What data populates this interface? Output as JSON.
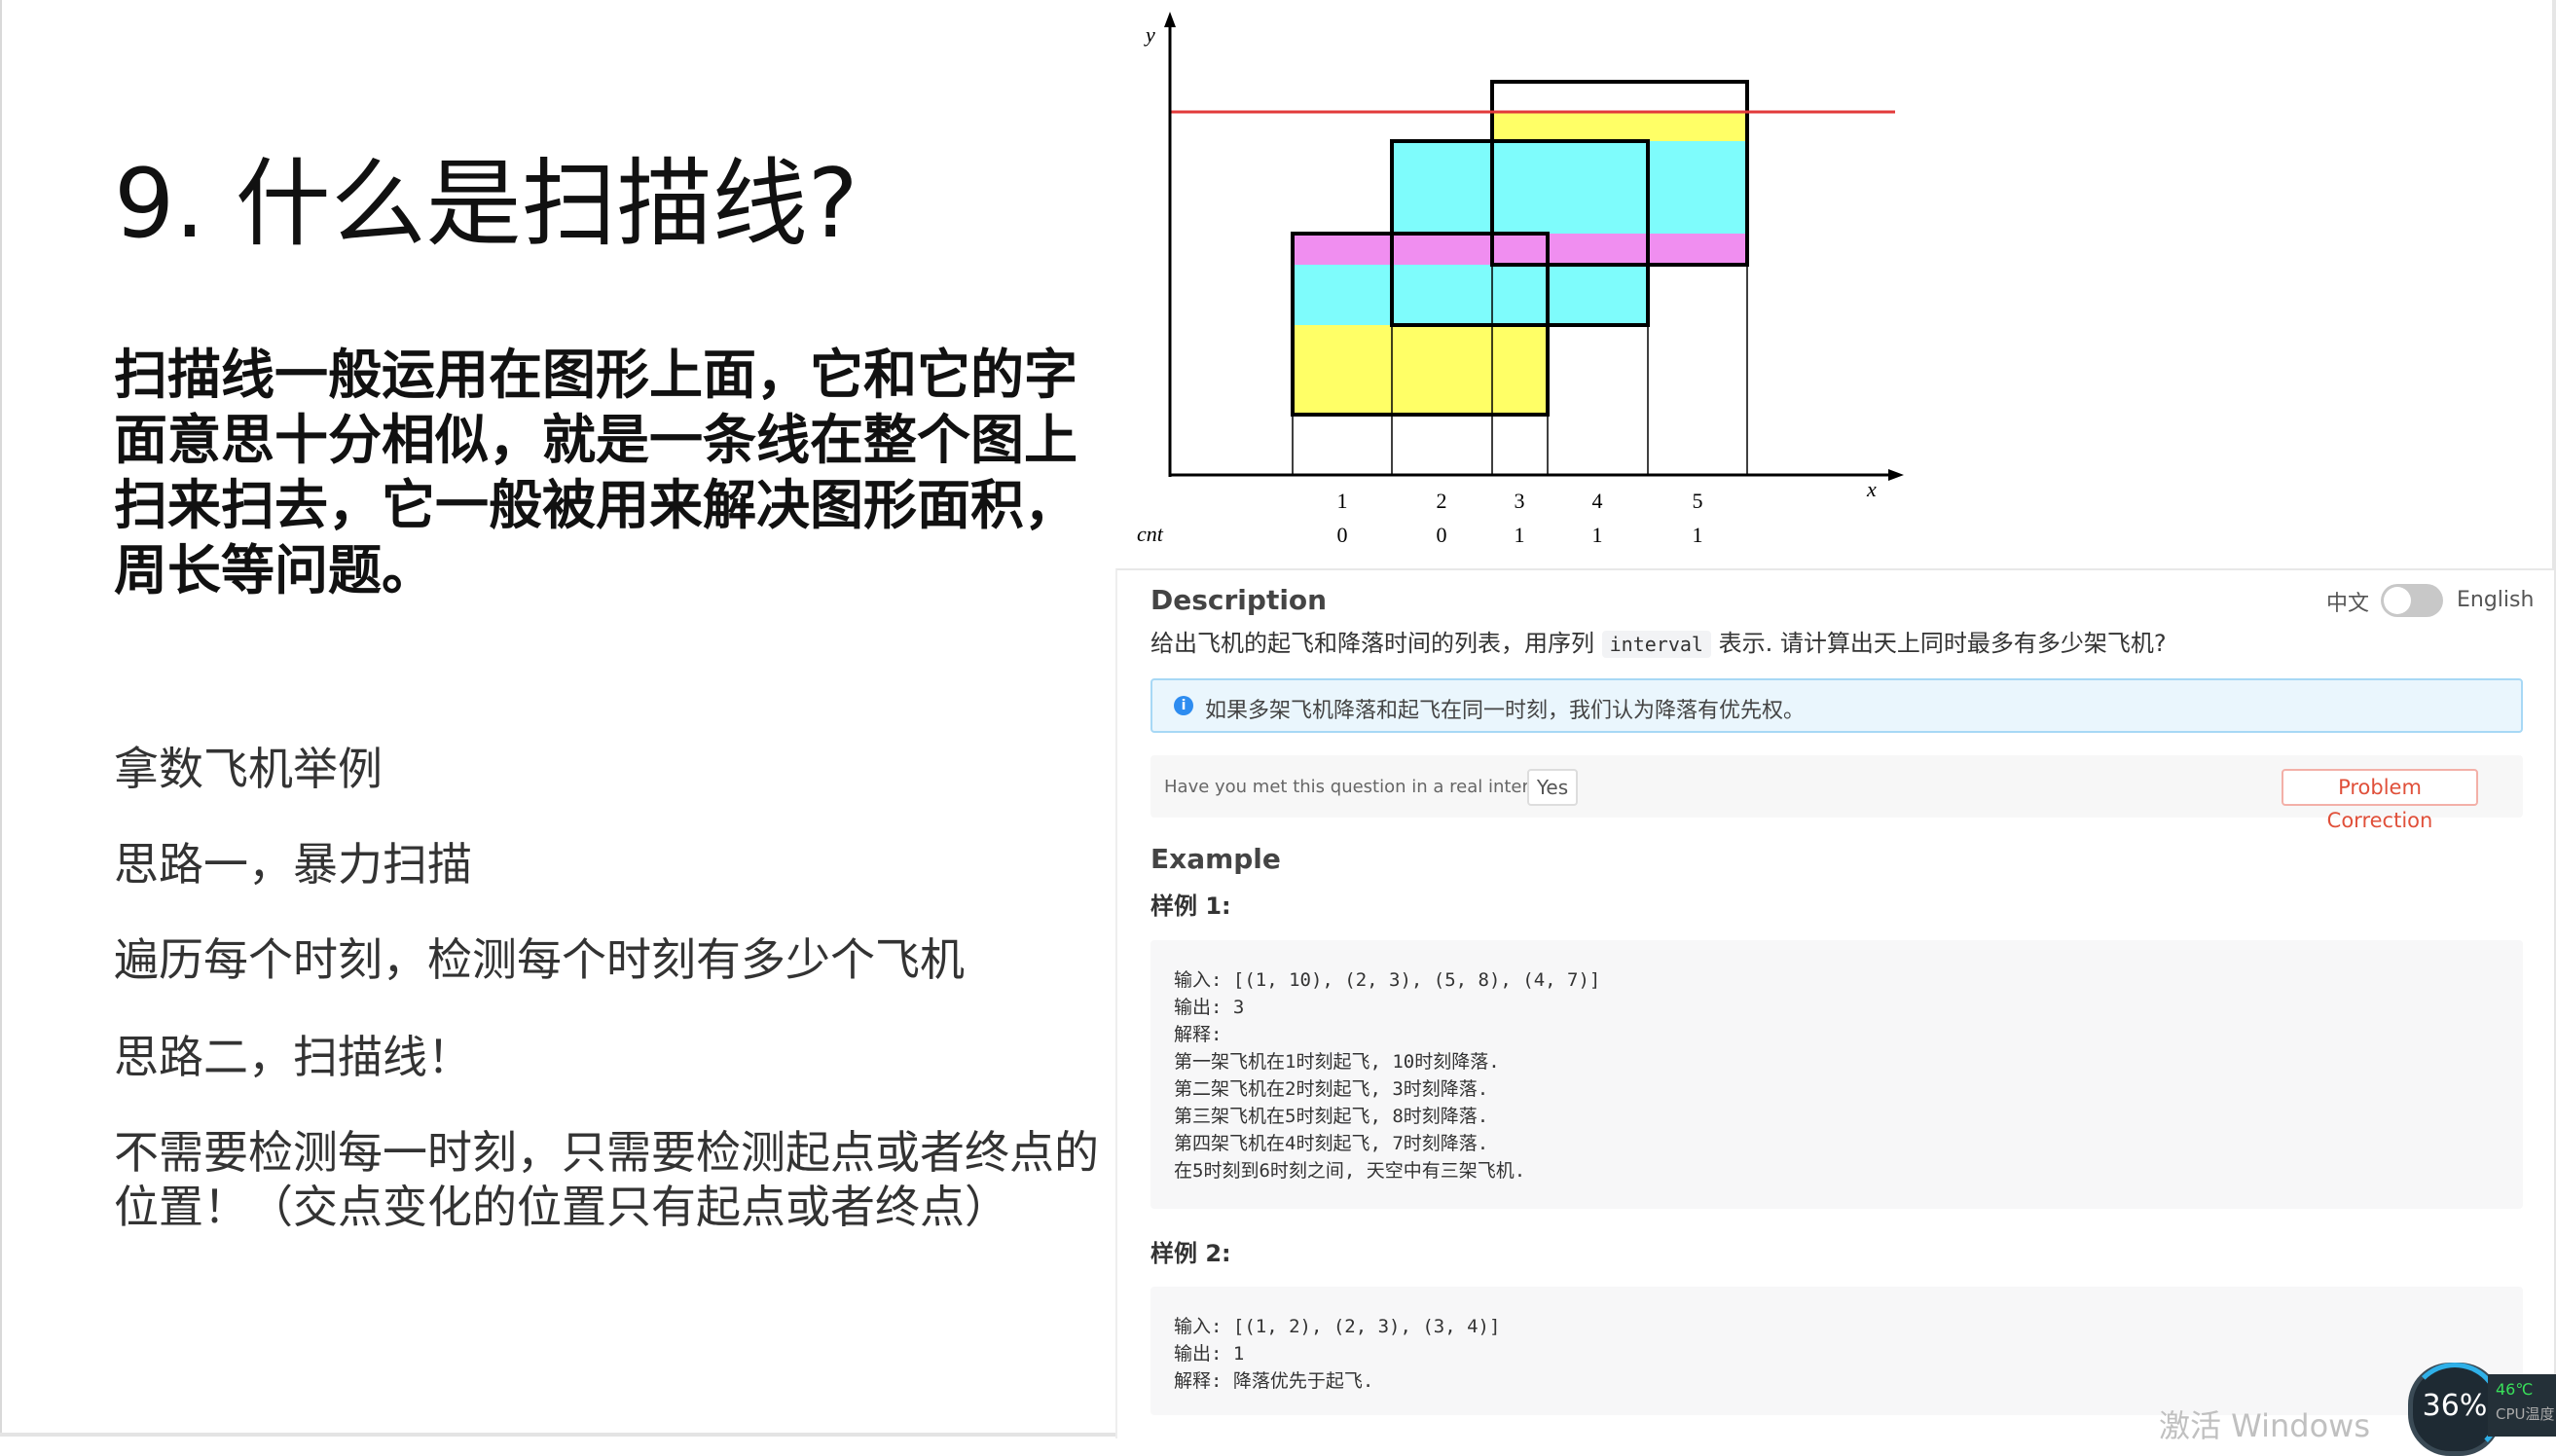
{
  "slide": {
    "title": "9. 什么是扫描线?",
    "intro": "扫描线一般运用在图形上面，它和它的字面意思十分相似，就是一条线在整个图上扫来扫去，它一般被用来解决图形面积，周长等问题。",
    "bullets": [
      "拿数飞机举例",
      "思路一，暴力扫描",
      "遍历每个时刻，检测每个时刻有多少个飞机",
      "思路二，扫描线！",
      "不需要检测每一时刻，只需要检测起点或者终点的位置！（交点变化的位置只有起点或者终点）"
    ]
  },
  "diagram": {
    "y_label": "y",
    "x_label": "x",
    "cnt_label": "cnt",
    "x_ticks": [
      "1",
      "2",
      "3",
      "4",
      "5"
    ],
    "cnt_values": [
      "0",
      "0",
      "1",
      "1",
      "1"
    ],
    "colors": {
      "yellow": "#ffff66",
      "cyan": "#7efcfc",
      "magenta": "#f08ef0",
      "scanline": "#e23a3a"
    }
  },
  "problem": {
    "description_heading": "Description",
    "lang_zh": "中文",
    "lang_en": "English",
    "desc_before": "给出飞机的起飞和降落时间的列表，用序列 ",
    "desc_code": "interval",
    "desc_after": " 表示. 请计算出天上同时最多有多少架飞机?",
    "info_icon": "i",
    "info_text": "如果多架飞机降落和起飞在同一时刻，我们认为降落有优先权。",
    "feedback_question": "Have you met this question in a real interview?",
    "feedback_yes": "Yes",
    "problem_correction": "Problem Correction",
    "example_heading": "Example",
    "sample1_label": "样例 1:",
    "sample1_lines": [
      "输入: [(1, 10), (2, 3), (5, 8), (4, 7)]",
      "输出: 3",
      "解释:",
      "第一架飞机在1时刻起飞, 10时刻降落.",
      "第二架飞机在2时刻起飞, 3时刻降落.",
      "第三架飞机在5时刻起飞, 8时刻降落.",
      "第四架飞机在4时刻起飞, 7时刻降落.",
      "在5时刻到6时刻之间, 天空中有三架飞机."
    ],
    "sample2_label": "样例 2:",
    "sample2_lines": [
      "输入: [(1, 2), (2, 3), (3, 4)]",
      "输出: 1",
      "解释: 降落优先于起飞."
    ]
  },
  "system": {
    "watermark": "激活 Windows",
    "cpu_percent": "36%",
    "cpu_temp": "46℃",
    "cpu_label": "CPU温度"
  }
}
